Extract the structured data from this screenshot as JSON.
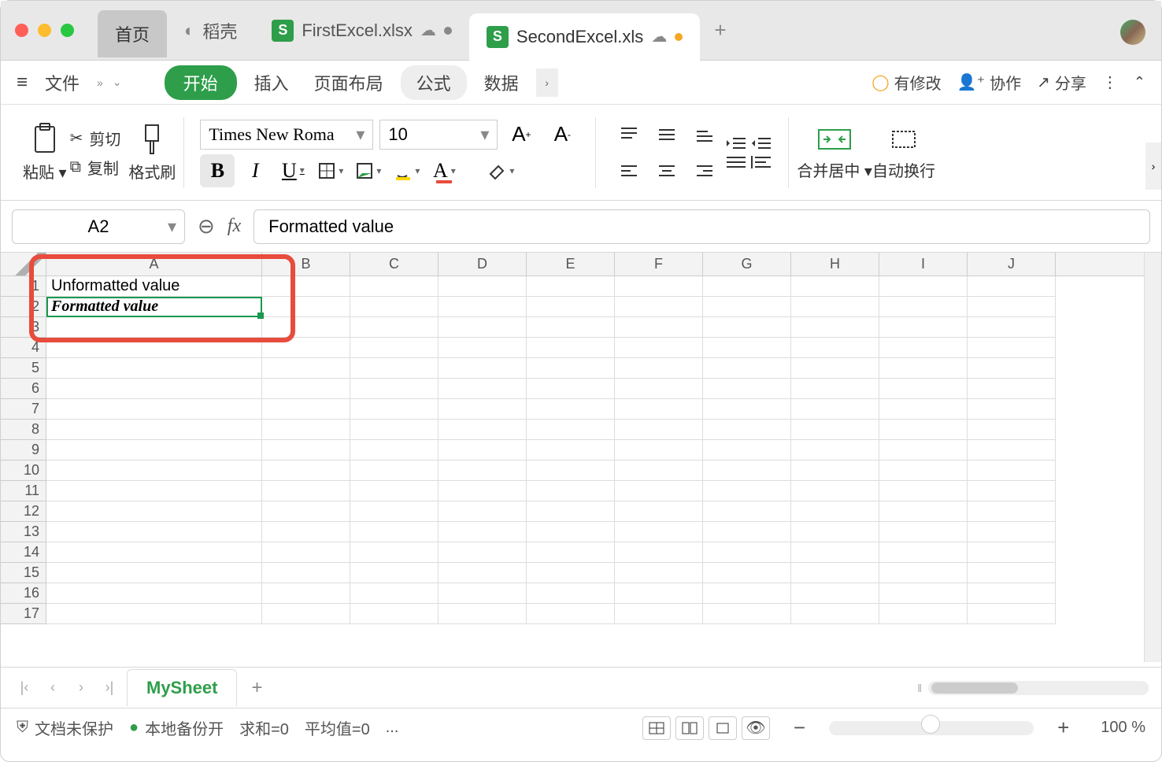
{
  "titlebar": {
    "home_tab": "首页",
    "docer_tab": "稻壳",
    "tab1": "FirstExcel.xlsx",
    "tab2": "SecondExcel.xls"
  },
  "menu": {
    "file": "文件",
    "start": "开始",
    "insert": "插入",
    "layout": "页面布局",
    "formula": "公式",
    "data": "数据",
    "has_changes": "有修改",
    "collab": "协作",
    "share": "分享"
  },
  "ribbon": {
    "paste": "粘贴",
    "cut": "剪切",
    "copy": "复制",
    "format_painter": "格式刷",
    "font_name": "Times New Roma",
    "font_size": "10",
    "merge_center": "合并居中",
    "wrap_text": "自动换行"
  },
  "formula_bar": {
    "name_box": "A2",
    "formula": "Formatted value"
  },
  "grid": {
    "cols": [
      "A",
      "B",
      "C",
      "D",
      "E",
      "F",
      "G",
      "H",
      "I",
      "J"
    ],
    "rows": [
      1,
      2,
      3,
      4,
      5,
      6,
      7,
      8,
      9,
      10,
      11,
      12,
      13,
      14,
      15,
      16,
      17
    ],
    "cells": {
      "A1": "Unformatted value",
      "A2": "Formatted value"
    }
  },
  "sheet": {
    "name": "MySheet"
  },
  "status": {
    "protect": "文档未保护",
    "backup": "本地备份开",
    "sum": "求和=0",
    "avg": "平均值=0",
    "more": "...",
    "zoom": "100 %"
  }
}
